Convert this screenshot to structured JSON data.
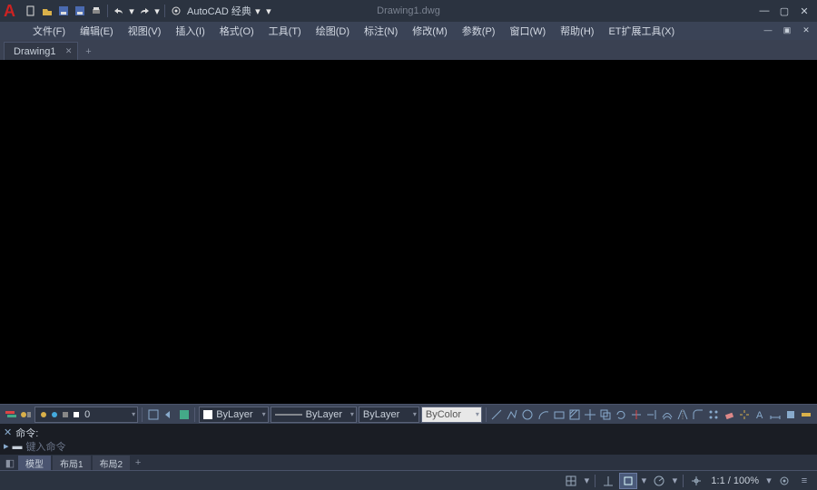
{
  "app": {
    "title": "Drawing1.dwg",
    "search_label": "AutoCAD 经典"
  },
  "qat": {
    "new": "新建",
    "open": "打开",
    "save": "保存",
    "saveas": "另存",
    "print": "打印",
    "undo": "撤销",
    "redo": "重做"
  },
  "menubar": {
    "items": [
      "文件(F)",
      "编辑(E)",
      "视图(V)",
      "插入(I)",
      "格式(O)",
      "工具(T)",
      "绘图(D)",
      "标注(N)",
      "修改(M)",
      "参数(P)",
      "窗口(W)",
      "帮助(H)",
      "ET扩展工具(X)"
    ]
  },
  "tabs": {
    "items": [
      {
        "label": "Drawing1"
      }
    ]
  },
  "props": {
    "layer_combo": "0",
    "linetype_combo": "ByLayer",
    "lineweight_combo": "ByLayer",
    "color_combo": "ByLayer",
    "plotstyle_combo": "ByColor"
  },
  "cmd": {
    "line1": "命令:",
    "line2": "命令:",
    "prompt": "键入命令"
  },
  "layout": {
    "tabs": [
      "模型",
      "布局1",
      "布局2"
    ]
  },
  "status": {
    "zoom": "1:1 / 100%"
  }
}
